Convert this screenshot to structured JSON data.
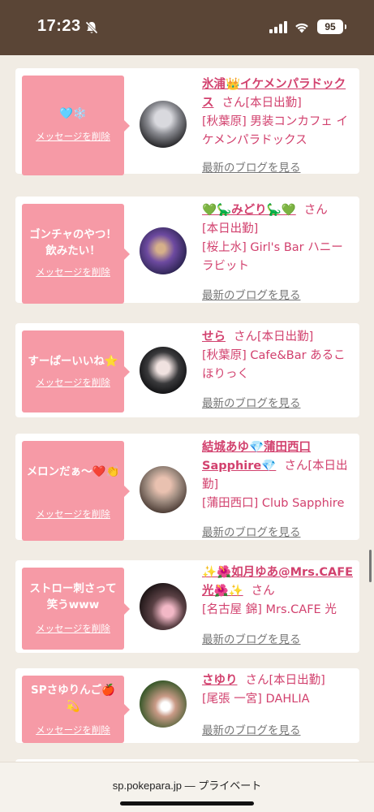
{
  "status_bar": {
    "time": "17:23",
    "battery": "95",
    "icons": [
      "bell-muted-icon",
      "cellular-signal-icon",
      "wifi-icon",
      "battery-icon"
    ]
  },
  "blog_link_label": "最新のブログを見る",
  "delete_label": "メッセージを削除",
  "san_label": "さん",
  "cards": [
    {
      "message": "🩵❄️",
      "cast_name": "氷浦👑イケメンパラドックス",
      "attendance": "[本日出勤]",
      "shop": "[秋葉原] 男装コンカフェ イケメンパラドックス"
    },
    {
      "message": "ゴンチャのやつ！飲みたい！",
      "cast_name": "💚🦕みどり🦕💚",
      "attendance": "[本日出勤]",
      "shop": "[桜上水] Girl's Bar ハニーラビット"
    },
    {
      "message": "すーぱーいいね⭐",
      "cast_name": "せら",
      "attendance": "[本日出勤]",
      "shop": "[秋葉原] Cafe&Bar あるこほりっく"
    },
    {
      "message": "メロンだぁ〜❤️👏",
      "cast_name": "結城あゆ💎蒲田西口Sapphire💎",
      "attendance": "[本日出勤]",
      "shop": "[蒲田西口] Club Sapphire"
    },
    {
      "message": "ストロー刺さって笑うwww",
      "cast_name": "✨🌺如月ゆあ@Mrs.CAFE光🌺✨",
      "attendance": "",
      "shop": "[名古屋 錦] Mrs.CAFE 光"
    },
    {
      "message": "SPさゆりんご🍎💫",
      "cast_name": "さゆり",
      "attendance": "[本日出勤]",
      "shop": "[尾張 一宮] DAHLIA"
    }
  ],
  "browser": {
    "url": "sp.pokepara.jp — プライベート"
  }
}
